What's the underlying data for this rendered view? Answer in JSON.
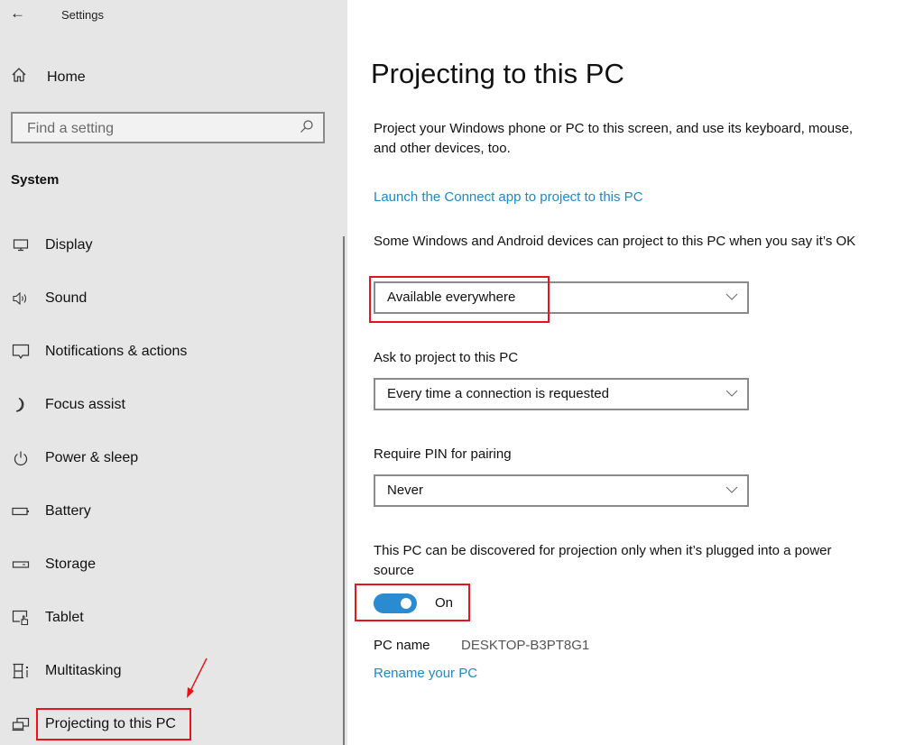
{
  "window": {
    "title": "Settings",
    "back_icon": "←"
  },
  "sidebar": {
    "home": {
      "label": "Home",
      "icon": "⌂"
    },
    "search": {
      "placeholder": "Find a setting",
      "icon": "⚲"
    },
    "section_title": "System",
    "items": [
      {
        "label": "Display",
        "icon": "display-icon"
      },
      {
        "label": "Sound",
        "icon": "sound-icon"
      },
      {
        "label": "Notifications & actions",
        "icon": "notifications-icon"
      },
      {
        "label": "Focus assist",
        "icon": "moon-icon"
      },
      {
        "label": "Power & sleep",
        "icon": "power-icon"
      },
      {
        "label": "Battery",
        "icon": "battery-icon"
      },
      {
        "label": "Storage",
        "icon": "storage-icon"
      },
      {
        "label": "Tablet",
        "icon": "tablet-icon"
      },
      {
        "label": "Multitasking",
        "icon": "multitasking-icon"
      },
      {
        "label": "Projecting to this PC",
        "icon": "projecting-icon",
        "selected": true
      }
    ]
  },
  "main": {
    "title": "Projecting to this PC",
    "description": "Project your Windows phone or PC to this screen, and use its keyboard, mouse, and other devices, too.",
    "connect_link": "Launch the Connect app to project to this PC",
    "availability": {
      "label": "Some Windows and Android devices can project to this PC when you say it’s OK",
      "value": "Available everywhere"
    },
    "ask": {
      "label": "Ask to project to this PC",
      "value": "Every time a connection is requested"
    },
    "pin": {
      "label": "Require PIN for pairing",
      "value": "Never"
    },
    "power": {
      "label": "This PC can be discovered for projection only when it’s plugged into a power source",
      "toggle_state": "On"
    },
    "pc_name": {
      "label": "PC name",
      "value": "DESKTOP-B3PT8G1"
    },
    "rename_link": "Rename your PC"
  },
  "colors": {
    "accent": "#2a8bd0",
    "link": "#1e88c8",
    "annotation": "#e8141b",
    "sidebar_bg": "#e6e6e6"
  }
}
